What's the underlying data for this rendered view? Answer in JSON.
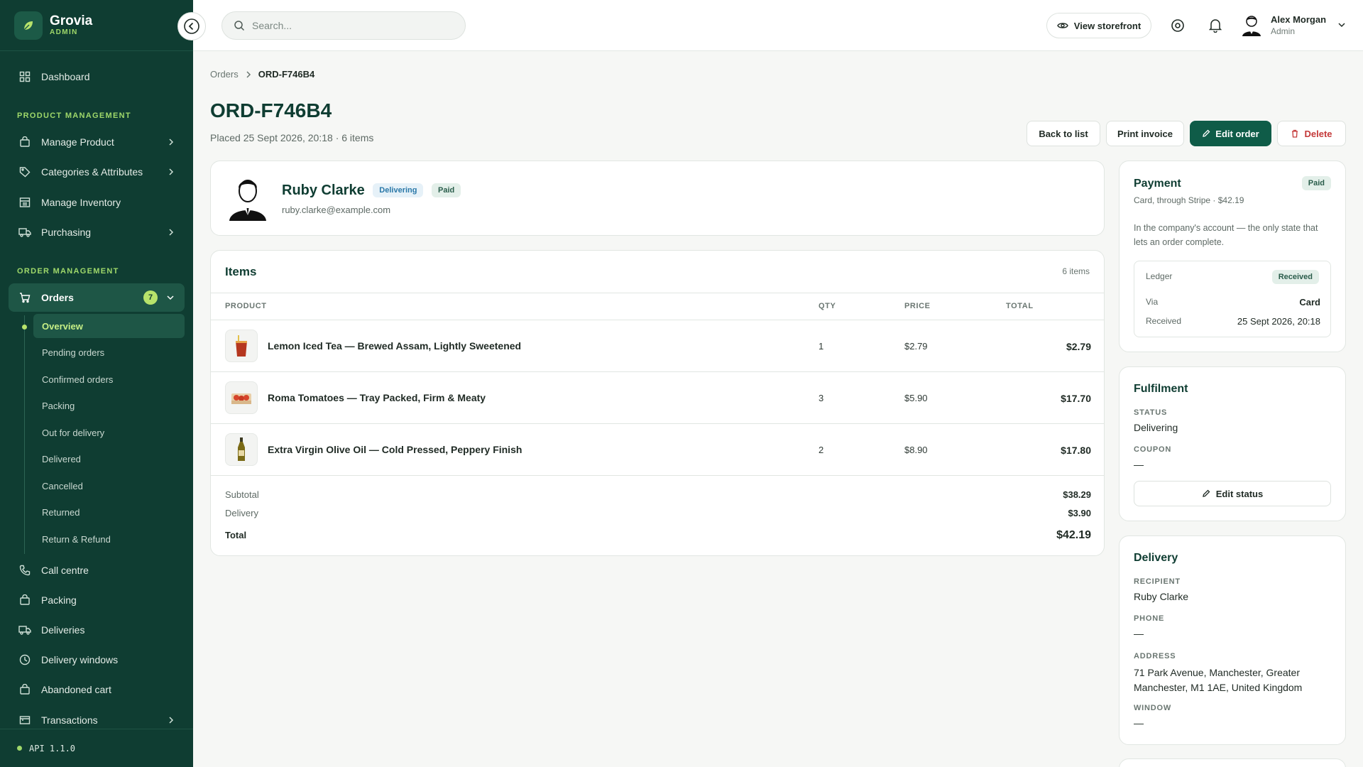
{
  "brand": {
    "name": "Grovia",
    "sub": "ADMIN"
  },
  "sidebar": {
    "dashboard": "Dashboard",
    "section_product": "PRODUCT MANAGEMENT",
    "manage_product": "Manage Product",
    "categories": "Categories & Attributes",
    "inventory": "Manage Inventory",
    "purchasing": "Purchasing",
    "section_order": "ORDER MANAGEMENT",
    "orders": "Orders",
    "orders_badge": "7",
    "sub": [
      "Overview",
      "Pending orders",
      "Confirmed orders",
      "Packing",
      "Out for delivery",
      "Delivered",
      "Cancelled",
      "Returned",
      "Return & Refund"
    ],
    "call_centre": "Call centre",
    "packing": "Packing",
    "deliveries": "Deliveries",
    "delivery_windows": "Delivery windows",
    "abandoned_cart": "Abandoned cart",
    "transactions": "Transactions",
    "api_version": "API 1.1.0"
  },
  "header": {
    "search_placeholder": "Search...",
    "view_storefront": "View storefront",
    "user_name": "Alex Morgan",
    "user_role": "Admin"
  },
  "breadcrumb": {
    "parent": "Orders",
    "current": "ORD-F746B4"
  },
  "order": {
    "title": "ORD-F746B4",
    "subtitle": "Placed 25 Sept 2026, 20:18 · 6 items",
    "actions": {
      "back": "Back to list",
      "print": "Print invoice",
      "edit": "Edit order",
      "delete": "Delete"
    }
  },
  "customer": {
    "name": "Ruby Clarke",
    "status": "Delivering",
    "payment": "Paid",
    "email": "ruby.clarke@example.com"
  },
  "items": {
    "title": "Items",
    "count": "6 items",
    "headers": {
      "product": "PRODUCT",
      "qty": "QTY",
      "price": "PRICE",
      "total": "TOTAL"
    },
    "rows": [
      {
        "name": "Lemon Iced Tea — Brewed Assam, Lightly Sweetened",
        "qty": "1",
        "price": "$2.79",
        "total": "$2.79",
        "icon": "iced-tea-icon"
      },
      {
        "name": "Roma Tomatoes — Tray Packed, Firm & Meaty",
        "qty": "3",
        "price": "$5.90",
        "total": "$17.70",
        "icon": "tomato-tray-icon"
      },
      {
        "name": "Extra Virgin Olive Oil — Cold Pressed, Peppery Finish",
        "qty": "2",
        "price": "$8.90",
        "total": "$17.80",
        "icon": "olive-oil-icon"
      }
    ],
    "subtotal_label": "Subtotal",
    "subtotal": "$38.29",
    "delivery_label": "Delivery",
    "delivery": "$3.90",
    "total_label": "Total",
    "total": "$42.19"
  },
  "payment": {
    "title": "Payment",
    "badge": "Paid",
    "method": "Card, through Stripe · $42.19",
    "note": "In the company's account — the only state that lets an order complete.",
    "ledger_label": "Ledger",
    "ledger_status": "Received",
    "via_label": "Via",
    "via": "Card",
    "received_label": "Received",
    "received": "25 Sept 2026, 20:18"
  },
  "fulfilment": {
    "title": "Fulfilment",
    "status_label": "STATUS",
    "status": "Delivering",
    "coupon_label": "COUPON",
    "coupon": "—",
    "edit_status": "Edit status"
  },
  "delivery": {
    "title": "Delivery",
    "recipient_label": "RECIPIENT",
    "recipient": "Ruby Clarke",
    "phone_label": "PHONE",
    "phone": "—",
    "address_label": "ADDRESS",
    "address": "71 Park Avenue, Manchester, Greater Manchester, M1 1AE, United Kingdom",
    "window_label": "WINDOW",
    "window": "—"
  },
  "colors": {
    "sidebar": "#0f3d32",
    "accent": "#9fd86a",
    "primary": "#0f5c48",
    "danger": "#c43a3a"
  }
}
